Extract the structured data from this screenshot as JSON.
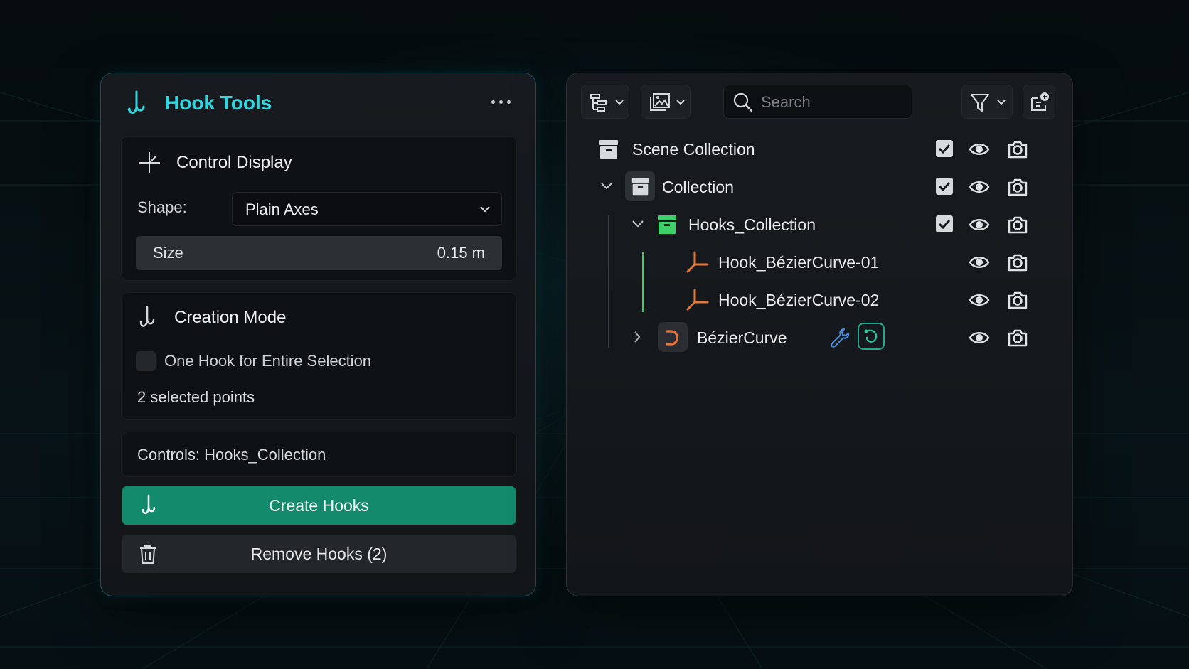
{
  "hook_tools": {
    "title": "Hook Tools",
    "more_icon": "ellipsis-icon",
    "control_display": {
      "title": "Control Display",
      "shape_label": "Shape:",
      "shape_value": "Plain Axes",
      "size_label": "Size",
      "size_value": "0.15 m"
    },
    "creation_mode": {
      "title": "Creation Mode",
      "checkbox_label": "One Hook for Entire Selection",
      "checkbox_checked": false,
      "selection_info": "2 selected points"
    },
    "controls_text": "Controls: Hooks_Collection",
    "create_button": "Create Hooks",
    "remove_button": "Remove Hooks (2)",
    "accent_color": "#2fd6e0",
    "create_color": "#138a6b"
  },
  "outliner": {
    "search_placeholder": "Search",
    "rows": [
      {
        "label": "Scene Collection",
        "icon": "collection-box-icon",
        "checked": true
      },
      {
        "label": "Collection",
        "icon": "collection-box-icon",
        "expanded": true,
        "checked": true
      },
      {
        "label": "Hooks_Collection",
        "icon": "collection-box-icon",
        "icon_color": "#3ccf6a",
        "expanded": true,
        "checked": true
      },
      {
        "label": "Hook_BézierCurve-01",
        "icon": "empty-axes-icon",
        "icon_color": "#e07a3c"
      },
      {
        "label": "Hook_BézierCurve-02",
        "icon": "empty-axes-icon",
        "icon_color": "#e07a3c"
      },
      {
        "label": "BézierCurve",
        "icon": "curve-object-icon",
        "icon_color": "#e8743a",
        "expanded": false,
        "modifier_icon": "wrench-icon",
        "data_icon": "curve-data-icon"
      }
    ]
  }
}
